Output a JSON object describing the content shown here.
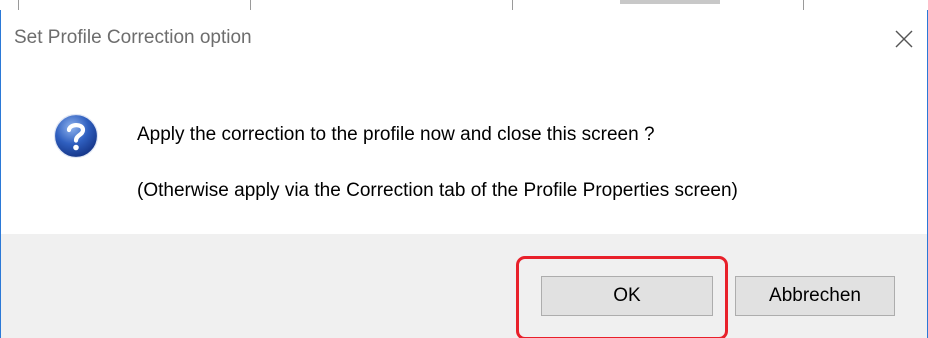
{
  "dialog": {
    "title": "Set Profile Correction option",
    "close_icon": "close-icon",
    "message_icon": "question-icon",
    "message_line1": "Apply the correction to the profile now and close this screen ?",
    "message_line2": "(Otherwise apply via the Correction tab of the Profile Properties screen)",
    "buttons": {
      "ok_label": "OK",
      "cancel_label": "Abbrechen"
    }
  },
  "colors": {
    "window_border": "#2b79d7",
    "footer_background": "#f0f0f0",
    "button_background": "#e1e1e1",
    "highlight_annotation": "#e8202a",
    "icon_blue": "#1e4fa8"
  }
}
